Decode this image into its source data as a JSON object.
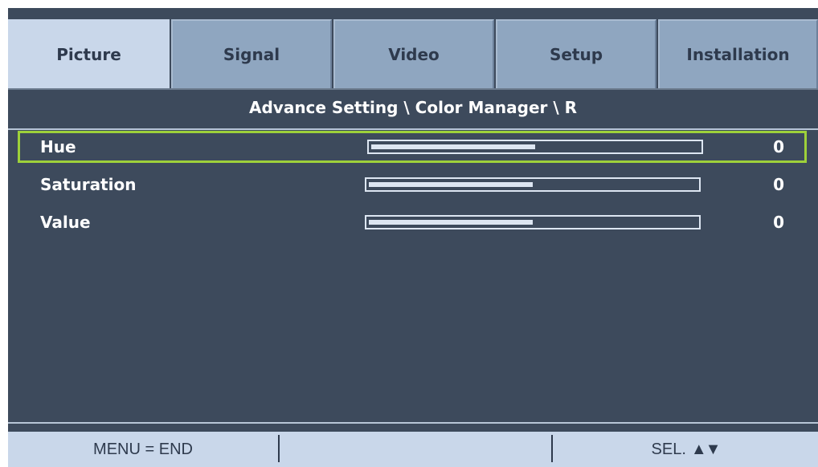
{
  "tabs": [
    {
      "label": "Picture",
      "active": true
    },
    {
      "label": "Signal",
      "active": false
    },
    {
      "label": "Video",
      "active": false
    },
    {
      "label": "Setup",
      "active": false
    },
    {
      "label": "Installation",
      "active": false
    }
  ],
  "breadcrumb": "Advance Setting \\ Color Manager \\ R",
  "rows": [
    {
      "label": "Hue",
      "value": "0",
      "level_fraction": 0.5,
      "selected": true
    },
    {
      "label": "Saturation",
      "value": "0",
      "level_fraction": 0.5,
      "selected": false
    },
    {
      "label": "Value",
      "value": "0",
      "level_fraction": 0.5,
      "selected": false
    }
  ],
  "footer": {
    "menu_hint": "MENU = END",
    "select_hint": "SEL.",
    "select_arrows": "▲▼"
  },
  "colors": {
    "background": "#3d4a5c",
    "active_tab": "#c9d7ea",
    "inactive_tab": "#8fa6c0",
    "selection_border": "#9ed13a"
  }
}
